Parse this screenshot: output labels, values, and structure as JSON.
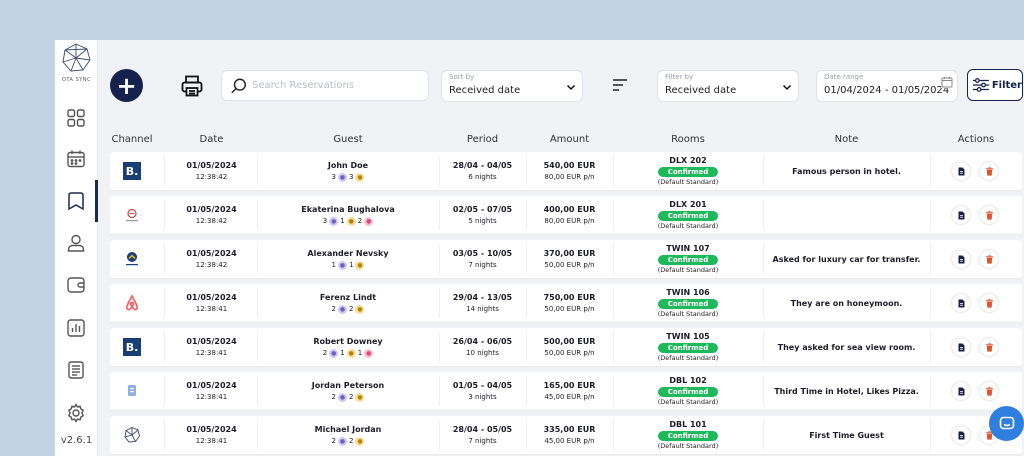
{
  "app": {
    "logo_text": "OTA SYNC",
    "version": "v2.6.1"
  },
  "sidebar": {
    "items": [
      {
        "name": "dashboard",
        "icon": "grid-icon"
      },
      {
        "name": "calendar",
        "icon": "calendar-icon"
      },
      {
        "name": "reservations",
        "icon": "bookmark-icon",
        "active": true
      },
      {
        "name": "guests",
        "icon": "user-icon"
      },
      {
        "name": "wallet",
        "icon": "wallet-icon"
      },
      {
        "name": "reports",
        "icon": "bar-chart-icon"
      },
      {
        "name": "documents",
        "icon": "document-icon"
      },
      {
        "name": "settings",
        "icon": "gear-icon"
      }
    ]
  },
  "toolbar": {
    "add_label": "+",
    "search_placeholder": "Search Reservations",
    "sort": {
      "caption": "Sort by",
      "value": "Received date"
    },
    "filter_by": {
      "caption": "Filter by",
      "value": "Received date"
    },
    "date_range": {
      "caption": "Date range",
      "value": "01/04/2024 - 01/05/2024"
    },
    "filter_label": "Filter"
  },
  "columns": [
    "Channel",
    "Date",
    "Guest",
    "Period",
    "Amount",
    "Rooms",
    "Note",
    "Actions"
  ],
  "colors": {
    "primary": "#15224d",
    "confirmed": "#1fb85a",
    "delete": "#e5532d"
  },
  "rows": [
    {
      "channel": "booking",
      "date": "01/05/2024",
      "time": "12:38:42",
      "guest": "John Doe",
      "adults": "3",
      "children": "3",
      "babies": null,
      "period": "28/04 - 04/05",
      "nights": "6 nights",
      "amount": "540,00 EUR",
      "per_night": "80,00 EUR p/n",
      "room": "DLX 202",
      "status": "Confirmed",
      "plan": "(Default Standard)",
      "note": "Famous person in hotel."
    },
    {
      "channel": "hotel-site",
      "date": "01/05/2024",
      "time": "12:38:42",
      "guest": "Ekaterina Bughalova",
      "adults": "3",
      "children": "1",
      "babies": "2",
      "period": "02/05 - 07/05",
      "nights": "5 nights",
      "amount": "400,00 EUR",
      "per_night": "80,00 EUR p/n",
      "room": "DLX 201",
      "status": "Confirmed",
      "plan": "(Default Standard)",
      "note": ""
    },
    {
      "channel": "expedia",
      "date": "01/05/2024",
      "time": "12:38:42",
      "guest": "Alexander Nevsky",
      "adults": "1",
      "children": "1",
      "babies": null,
      "period": "03/05 - 10/05",
      "nights": "7 nights",
      "amount": "370,00 EUR",
      "per_night": "50,00 EUR p/n",
      "room": "TWIN 107",
      "status": "Confirmed",
      "plan": "(Default Standard)",
      "note": "Asked for luxury car for transfer."
    },
    {
      "channel": "airbnb",
      "date": "01/05/2024",
      "time": "12:38:41",
      "guest": "Ferenz Lindt",
      "adults": "2",
      "children": "2",
      "babies": null,
      "period": "29/04 - 13/05",
      "nights": "14 nights",
      "amount": "750,00 EUR",
      "per_night": "50,00 EUR p/n",
      "room": "TWIN 106",
      "status": "Confirmed",
      "plan": "(Default Standard)",
      "note": "They are on honeymoon."
    },
    {
      "channel": "booking",
      "date": "01/05/2024",
      "time": "12:38:41",
      "guest": "Robert Downey",
      "adults": "2",
      "children": "1",
      "babies": "1",
      "period": "26/04 - 06/05",
      "nights": "10 nights",
      "amount": "500,00 EUR",
      "per_night": "50,00 EUR p/n",
      "room": "TWIN 105",
      "status": "Confirmed",
      "plan": "(Default Standard)",
      "note": "They asked for sea view room."
    },
    {
      "channel": "direct",
      "date": "01/05/2024",
      "time": "12:38:41",
      "guest": "Jordan Peterson",
      "adults": "2",
      "children": "2",
      "babies": null,
      "period": "01/05 - 04/05",
      "nights": "3 nights",
      "amount": "165,00 EUR",
      "per_night": "45,00 EUR p/n",
      "room": "DBL 102",
      "status": "Confirmed",
      "plan": "(Default Standard)",
      "note": "Third Time in Hotel, Likes Pizza."
    },
    {
      "channel": "ota-sync",
      "date": "01/05/2024",
      "time": "12:38:41",
      "guest": "Michael Jordan",
      "adults": "2",
      "children": "2",
      "babies": null,
      "period": "28/04 - 05/05",
      "nights": "7 nights",
      "amount": "335,00 EUR",
      "per_night": "45,00 EUR p/n",
      "room": "DBL 101",
      "status": "Confirmed",
      "plan": "(Default Standard)",
      "note": "First Time Guest"
    }
  ]
}
